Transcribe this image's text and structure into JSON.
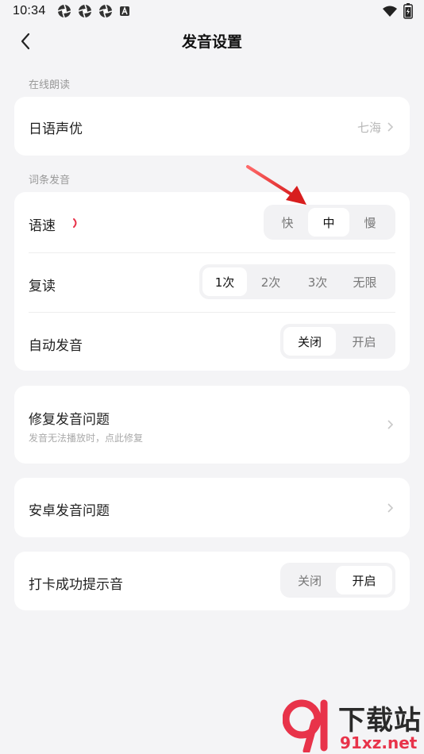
{
  "status": {
    "time": "10:34",
    "icons": [
      "aperture-icon",
      "aperture-icon",
      "aperture-icon",
      "a-badge-icon"
    ],
    "right_icons": [
      "wifi-icon",
      "battery-icon"
    ]
  },
  "nav": {
    "title": "发音设置",
    "back_icon": "chevron-left-icon"
  },
  "section_online": {
    "label": "在线朗读",
    "row": {
      "title": "日语声优",
      "value": "七海"
    }
  },
  "section_word": {
    "label": "词条发音",
    "speed": {
      "title": "语速",
      "options": [
        "快",
        "中",
        "慢"
      ],
      "selected": "中"
    },
    "repeat": {
      "title": "复读",
      "options": [
        "1次",
        "2次",
        "3次",
        "无限"
      ],
      "selected": "1次"
    },
    "auto": {
      "title": "自动发音",
      "options": [
        "关闭",
        "开启"
      ],
      "selected": "关闭"
    }
  },
  "fix": {
    "title": "修复发音问题",
    "subtitle": "发音无法播放时，点此修复"
  },
  "android": {
    "title": "安卓发音问题"
  },
  "checkin": {
    "title": "打卡成功提示音",
    "options": [
      "关闭",
      "开启"
    ],
    "selected": "开启"
  },
  "watermark": {
    "chars": "下载站",
    "domain": "91xz.net"
  },
  "colors": {
    "accent": "#e8334a",
    "card": "#ffffff",
    "background": "#f4f4f6"
  }
}
